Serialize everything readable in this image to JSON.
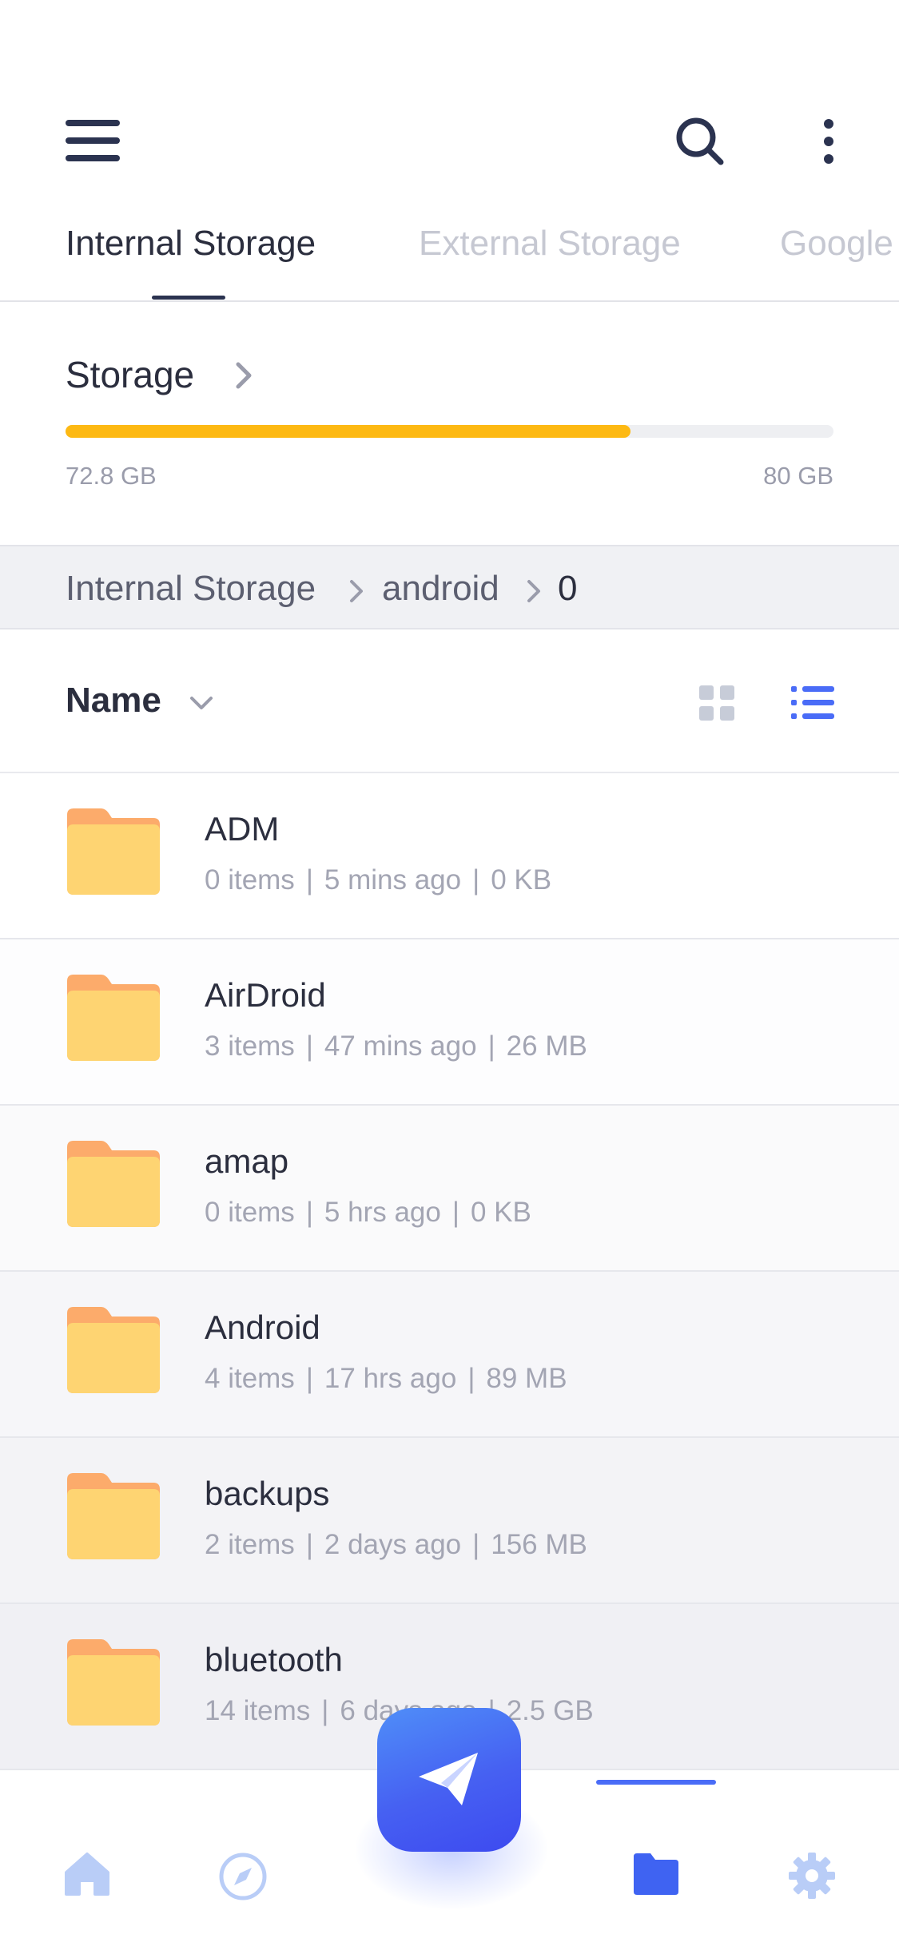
{
  "header": {
    "menu_icon": "hamburger-menu-icon",
    "search_icon": "search-icon",
    "more_icon": "more-vertical-icon",
    "tabs": [
      {
        "label": "Internal Storage",
        "active": true
      },
      {
        "label": "External Storage",
        "active": false
      },
      {
        "label": "Google Drive",
        "active": false
      }
    ]
  },
  "storage": {
    "title": "Storage",
    "used": "72.8 GB",
    "total": "80 GB",
    "used_fraction": 0.736,
    "bar_color": "#fdb913"
  },
  "breadcrumb": {
    "items": [
      "Internal Storage",
      "android",
      "0"
    ]
  },
  "sort": {
    "label": "Name",
    "view_mode": "list",
    "accent": "#4a6cf7"
  },
  "files": [
    {
      "name": "ADM",
      "items": "0 items",
      "modified": "5 mins ago",
      "size": "0 KB"
    },
    {
      "name": "AirDroid",
      "items": "3 items",
      "modified": "47 mins ago",
      "size": "26 MB"
    },
    {
      "name": "amap",
      "items": "0 items",
      "modified": "5 hrs ago",
      "size": "0 KB"
    },
    {
      "name": "Android",
      "items": "4 items",
      "modified": "17 hrs ago",
      "size": "89 MB"
    },
    {
      "name": "backups",
      "items": "2 items",
      "modified": "2 days ago",
      "size": "156 MB"
    },
    {
      "name": "bluetooth",
      "items": "14 items",
      "modified": "6 days ago",
      "size": "2.5 GB"
    }
  ],
  "bottom_nav": {
    "items": [
      "home-icon",
      "compass-icon",
      "folder-icon",
      "settings-icon"
    ],
    "active": "folder-icon",
    "fab_icon": "paper-plane-icon"
  }
}
